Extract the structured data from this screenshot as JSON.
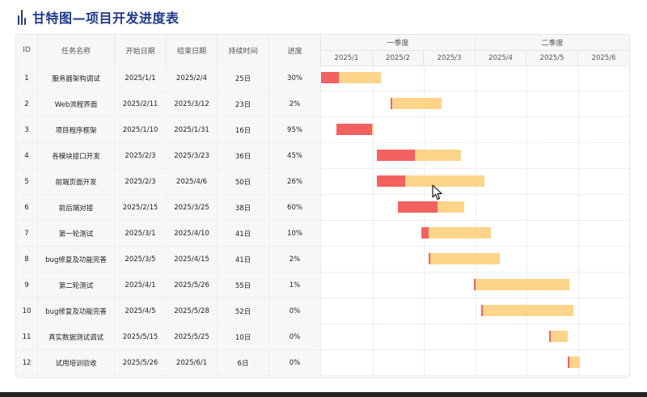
{
  "page": {
    "title": "甘特图—项目开发进度表"
  },
  "table": {
    "columns": [
      "ID",
      "任务名称",
      "开始日期",
      "结束日期",
      "持续时间",
      "进度"
    ],
    "quarters": [
      "一季度",
      "二季度"
    ],
    "months": [
      "2025/1",
      "2025/2",
      "2025/3",
      "2025/4",
      "2025/5",
      "2025/6"
    ]
  },
  "chart_data": {
    "type": "gantt",
    "title": "甘特图—项目开发进度表",
    "time_range": [
      "2025/1/1",
      "2025/6/30"
    ],
    "series": [
      {
        "name": "",
        "color": "#f46161"
      },
      {
        "name": "",
        "color": "#fdd48a"
      }
    ],
    "tasks": [
      {
        "id": "1",
        "name": "服务器架构调试",
        "start": "2025/1/1",
        "end": "2025/2/4",
        "duration": "25日",
        "progress_label": "30%",
        "progress": 0.3
      },
      {
        "id": "2",
        "name": "Web流程界面",
        "start": "2025/2/11",
        "end": "2025/3/12",
        "duration": "23日",
        "progress_label": "2%",
        "progress": 0.02
      },
      {
        "id": "3",
        "name": "项目程序框架",
        "start": "2025/1/10",
        "end": "2025/1/31",
        "duration": "16日",
        "progress_label": "95%",
        "progress": 0.95
      },
      {
        "id": "4",
        "name": "各模块接口开发",
        "start": "2025/2/3",
        "end": "2025/3/23",
        "duration": "36日",
        "progress_label": "45%",
        "progress": 0.45
      },
      {
        "id": "5",
        "name": "前端页面开发",
        "start": "2025/2/3",
        "end": "2025/4/6",
        "duration": "50日",
        "progress_label": "26%",
        "progress": 0.26
      },
      {
        "id": "6",
        "name": "前后端对接",
        "start": "2025/2/15",
        "end": "2025/3/25",
        "duration": "38日",
        "progress_label": "60%",
        "progress": 0.6
      },
      {
        "id": "7",
        "name": "第一轮测试",
        "start": "2025/3/1",
        "end": "2025/4/10",
        "duration": "41日",
        "progress_label": "10%",
        "progress": 0.1
      },
      {
        "id": "8",
        "name": "bug修复及功能完善",
        "start": "2025/3/5",
        "end": "2025/4/15",
        "duration": "41日",
        "progress_label": "2%",
        "progress": 0.02
      },
      {
        "id": "9",
        "name": "第二轮测试",
        "start": "2025/4/1",
        "end": "2025/5/26",
        "duration": "55日",
        "progress_label": "1%",
        "progress": 0.01
      },
      {
        "id": "10",
        "name": "bug修复及功能完善",
        "start": "2025/4/5",
        "end": "2025/5/28",
        "duration": "52日",
        "progress_label": "0%",
        "progress": 0.0
      },
      {
        "id": "11",
        "name": "真实数据测试调试",
        "start": "2025/5/15",
        "end": "2025/5/25",
        "duration": "10日",
        "progress_label": "0%",
        "progress": 0.0
      },
      {
        "id": "12",
        "name": "试用培训验收",
        "start": "2025/5/26",
        "end": "2025/6/1",
        "duration": "6日",
        "progress_label": "0%",
        "progress": 0.0
      }
    ]
  }
}
